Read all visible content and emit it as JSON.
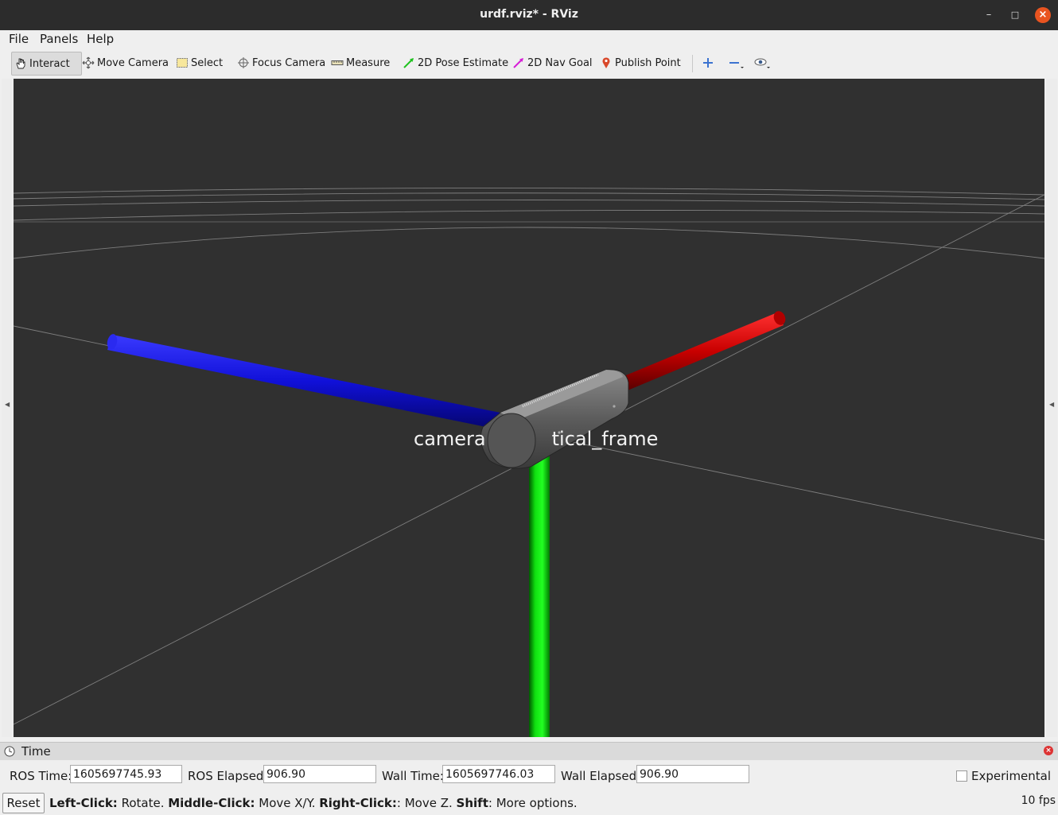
{
  "window": {
    "title": "urdf.rviz* - RViz"
  },
  "menu": {
    "items": [
      "File",
      "Panels",
      "Help"
    ]
  },
  "toolbar": {
    "tools": [
      {
        "label": "Interact",
        "icon": "hand-icon",
        "active": true
      },
      {
        "label": "Move Camera",
        "icon": "move-camera-icon"
      },
      {
        "label": "Select",
        "icon": "select-box-icon"
      },
      {
        "label": "Focus Camera",
        "icon": "focus-target-icon"
      },
      {
        "label": "Measure",
        "icon": "ruler-icon"
      },
      {
        "label": "2D Pose Estimate",
        "icon": "green-arrow-icon"
      },
      {
        "label": "2D Nav Goal",
        "icon": "magenta-arrow-icon"
      },
      {
        "label": "Publish Point",
        "icon": "map-pin-icon"
      }
    ],
    "extra_icons": [
      "add-tool-icon",
      "remove-tool-icon",
      "eye-icon"
    ]
  },
  "viewport": {
    "frame_label_left": "camera",
    "frame_label_right": "tical_frame",
    "axis_colors": {
      "x": "#cc0000",
      "y": "#00cc00",
      "z": "#0000dd"
    },
    "background": "#303030"
  },
  "time_panel": {
    "title": "Time",
    "ros_time_label": "ROS Time:",
    "ros_time": "1605697745.93",
    "ros_elapsed_label": "ROS Elapsed:",
    "ros_elapsed": "906.90",
    "wall_time_label": "Wall Time:",
    "wall_time": "1605697746.03",
    "wall_elapsed_label": "Wall Elapsed:",
    "wall_elapsed": "906.90",
    "experimental_label": "Experimental",
    "experimental_checked": false
  },
  "status": {
    "reset_label": "Reset",
    "hint_left_click": "Left-Click:",
    "hint_rotate": " Rotate. ",
    "hint_middle_click": "Middle-Click:",
    "hint_move_xy": " Move X/Y. ",
    "hint_right_click": "Right-Click:",
    "hint_move_z": ": Move Z. ",
    "hint_shift": "Shift",
    "hint_more": ": More options.",
    "fps": "10 fps"
  }
}
